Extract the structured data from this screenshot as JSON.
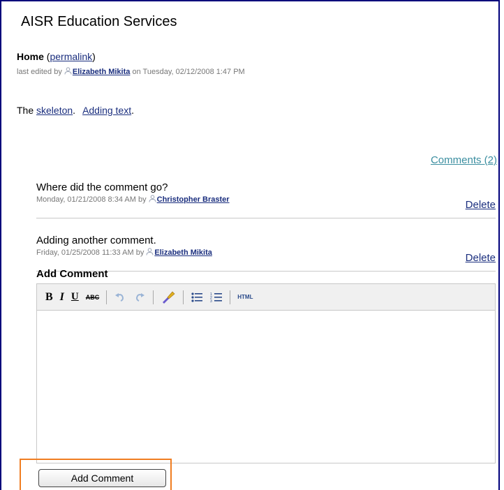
{
  "site": {
    "title": "AISR Education Services"
  },
  "page": {
    "title": "Home",
    "permalink_open": " (",
    "permalink_label": "permalink",
    "permalink_close": ")",
    "meta_prefix": "last edited by ",
    "author": "Elizabeth Mikita",
    "meta_suffix": " on Tuesday, 02/12/2008 1:47 PM",
    "body_prefix": "The ",
    "link1": "skeleton",
    "sep1": ".",
    "link2": "Adding text",
    "sep2": "."
  },
  "comments": {
    "header_link": "Comments (2)",
    "delete_label": "Delete",
    "by": " by ",
    "items": [
      {
        "text": "Where did the comment go?",
        "date": "Monday, 01/21/2008 8:34 AM",
        "author": "Christopher Braster"
      },
      {
        "text": "Adding another comment.",
        "date": "Friday, 01/25/2008 11:33 AM",
        "author": "Elizabeth Mikita"
      }
    ]
  },
  "add_comment": {
    "title": "Add Comment",
    "toolbar": {
      "bold": "B",
      "italic": "I",
      "underline": "U",
      "strike": "ABC",
      "undo_icon": "undo-icon",
      "redo_icon": "redo-icon",
      "clean_icon": "brush-icon",
      "ul_icon": "bulleted-list-icon",
      "ol_icon": "numbered-list-icon",
      "html": "HTML"
    },
    "editor_value": "",
    "button_label": "Add Comment"
  },
  "colors": {
    "link": "#1a2e7e",
    "comments_link": "#3b8ea0",
    "highlight": "#f07d21",
    "frame": "#00007b"
  }
}
